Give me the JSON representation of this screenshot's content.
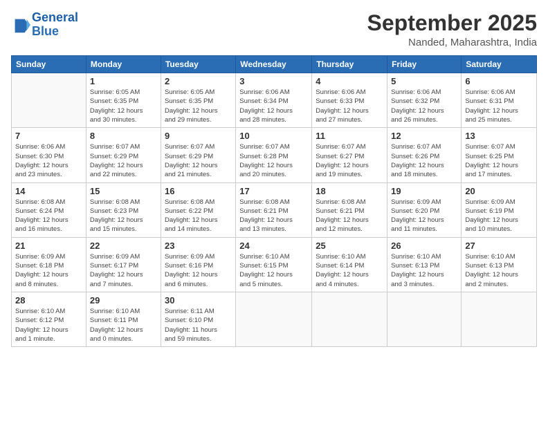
{
  "logo": {
    "line1": "General",
    "line2": "Blue"
  },
  "title": "September 2025",
  "location": "Nanded, Maharashtra, India",
  "days_header": [
    "Sunday",
    "Monday",
    "Tuesday",
    "Wednesday",
    "Thursday",
    "Friday",
    "Saturday"
  ],
  "weeks": [
    [
      {
        "num": "",
        "info": ""
      },
      {
        "num": "1",
        "info": "Sunrise: 6:05 AM\nSunset: 6:35 PM\nDaylight: 12 hours\nand 30 minutes."
      },
      {
        "num": "2",
        "info": "Sunrise: 6:05 AM\nSunset: 6:35 PM\nDaylight: 12 hours\nand 29 minutes."
      },
      {
        "num": "3",
        "info": "Sunrise: 6:06 AM\nSunset: 6:34 PM\nDaylight: 12 hours\nand 28 minutes."
      },
      {
        "num": "4",
        "info": "Sunrise: 6:06 AM\nSunset: 6:33 PM\nDaylight: 12 hours\nand 27 minutes."
      },
      {
        "num": "5",
        "info": "Sunrise: 6:06 AM\nSunset: 6:32 PM\nDaylight: 12 hours\nand 26 minutes."
      },
      {
        "num": "6",
        "info": "Sunrise: 6:06 AM\nSunset: 6:31 PM\nDaylight: 12 hours\nand 25 minutes."
      }
    ],
    [
      {
        "num": "7",
        "info": "Sunrise: 6:06 AM\nSunset: 6:30 PM\nDaylight: 12 hours\nand 23 minutes."
      },
      {
        "num": "8",
        "info": "Sunrise: 6:07 AM\nSunset: 6:29 PM\nDaylight: 12 hours\nand 22 minutes."
      },
      {
        "num": "9",
        "info": "Sunrise: 6:07 AM\nSunset: 6:29 PM\nDaylight: 12 hours\nand 21 minutes."
      },
      {
        "num": "10",
        "info": "Sunrise: 6:07 AM\nSunset: 6:28 PM\nDaylight: 12 hours\nand 20 minutes."
      },
      {
        "num": "11",
        "info": "Sunrise: 6:07 AM\nSunset: 6:27 PM\nDaylight: 12 hours\nand 19 minutes."
      },
      {
        "num": "12",
        "info": "Sunrise: 6:07 AM\nSunset: 6:26 PM\nDaylight: 12 hours\nand 18 minutes."
      },
      {
        "num": "13",
        "info": "Sunrise: 6:07 AM\nSunset: 6:25 PM\nDaylight: 12 hours\nand 17 minutes."
      }
    ],
    [
      {
        "num": "14",
        "info": "Sunrise: 6:08 AM\nSunset: 6:24 PM\nDaylight: 12 hours\nand 16 minutes."
      },
      {
        "num": "15",
        "info": "Sunrise: 6:08 AM\nSunset: 6:23 PM\nDaylight: 12 hours\nand 15 minutes."
      },
      {
        "num": "16",
        "info": "Sunrise: 6:08 AM\nSunset: 6:22 PM\nDaylight: 12 hours\nand 14 minutes."
      },
      {
        "num": "17",
        "info": "Sunrise: 6:08 AM\nSunset: 6:21 PM\nDaylight: 12 hours\nand 13 minutes."
      },
      {
        "num": "18",
        "info": "Sunrise: 6:08 AM\nSunset: 6:21 PM\nDaylight: 12 hours\nand 12 minutes."
      },
      {
        "num": "19",
        "info": "Sunrise: 6:09 AM\nSunset: 6:20 PM\nDaylight: 12 hours\nand 11 minutes."
      },
      {
        "num": "20",
        "info": "Sunrise: 6:09 AM\nSunset: 6:19 PM\nDaylight: 12 hours\nand 10 minutes."
      }
    ],
    [
      {
        "num": "21",
        "info": "Sunrise: 6:09 AM\nSunset: 6:18 PM\nDaylight: 12 hours\nand 8 minutes."
      },
      {
        "num": "22",
        "info": "Sunrise: 6:09 AM\nSunset: 6:17 PM\nDaylight: 12 hours\nand 7 minutes."
      },
      {
        "num": "23",
        "info": "Sunrise: 6:09 AM\nSunset: 6:16 PM\nDaylight: 12 hours\nand 6 minutes."
      },
      {
        "num": "24",
        "info": "Sunrise: 6:10 AM\nSunset: 6:15 PM\nDaylight: 12 hours\nand 5 minutes."
      },
      {
        "num": "25",
        "info": "Sunrise: 6:10 AM\nSunset: 6:14 PM\nDaylight: 12 hours\nand 4 minutes."
      },
      {
        "num": "26",
        "info": "Sunrise: 6:10 AM\nSunset: 6:13 PM\nDaylight: 12 hours\nand 3 minutes."
      },
      {
        "num": "27",
        "info": "Sunrise: 6:10 AM\nSunset: 6:13 PM\nDaylight: 12 hours\nand 2 minutes."
      }
    ],
    [
      {
        "num": "28",
        "info": "Sunrise: 6:10 AM\nSunset: 6:12 PM\nDaylight: 12 hours\nand 1 minute."
      },
      {
        "num": "29",
        "info": "Sunrise: 6:10 AM\nSunset: 6:11 PM\nDaylight: 12 hours\nand 0 minutes."
      },
      {
        "num": "30",
        "info": "Sunrise: 6:11 AM\nSunset: 6:10 PM\nDaylight: 11 hours\nand 59 minutes."
      },
      {
        "num": "",
        "info": ""
      },
      {
        "num": "",
        "info": ""
      },
      {
        "num": "",
        "info": ""
      },
      {
        "num": "",
        "info": ""
      }
    ]
  ]
}
